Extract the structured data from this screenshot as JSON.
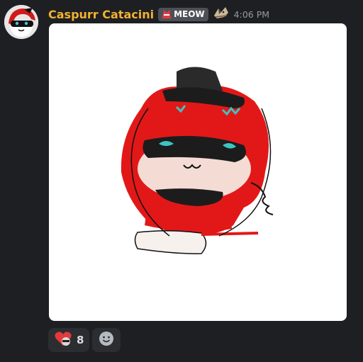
{
  "message": {
    "author": "Caspurr Catacini",
    "author_color": "#f0b232",
    "tag": {
      "label": "MEOW",
      "icon": "red-cat-icon"
    },
    "badge_icon": "cat-rider-icon",
    "timestamp": "4:06 PM",
    "avatar_icon": "red-hooded-cat-avatar",
    "attachment": {
      "type": "image",
      "description_icon": "red-cat-drawing"
    }
  },
  "reactions": [
    {
      "emoji_icon": "heart-cat-emoji",
      "count": "8"
    }
  ],
  "add_reaction_icon": "smiley-icon"
}
